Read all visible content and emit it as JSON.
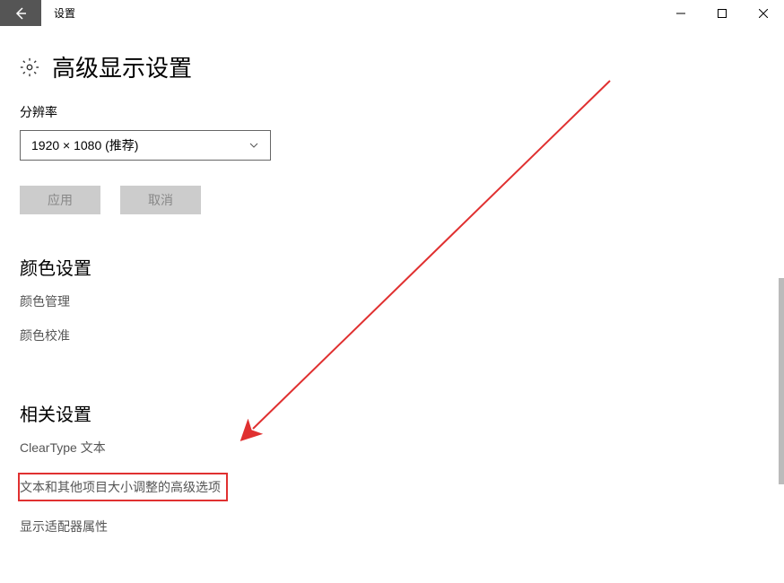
{
  "window": {
    "title": "设置"
  },
  "page": {
    "title": "高级显示设置"
  },
  "resolution": {
    "label": "分辨率",
    "value": "1920 × 1080 (推荐)"
  },
  "buttons": {
    "apply": "应用",
    "cancel": "取消"
  },
  "color_section": {
    "title": "颜色设置",
    "links": {
      "management": "颜色管理",
      "calibration": "颜色校准"
    }
  },
  "related_section": {
    "title": "相关设置",
    "links": {
      "cleartype": "ClearType 文本",
      "text_size": "文本和其他项目大小调整的高级选项",
      "adapter": "显示适配器属性"
    }
  }
}
